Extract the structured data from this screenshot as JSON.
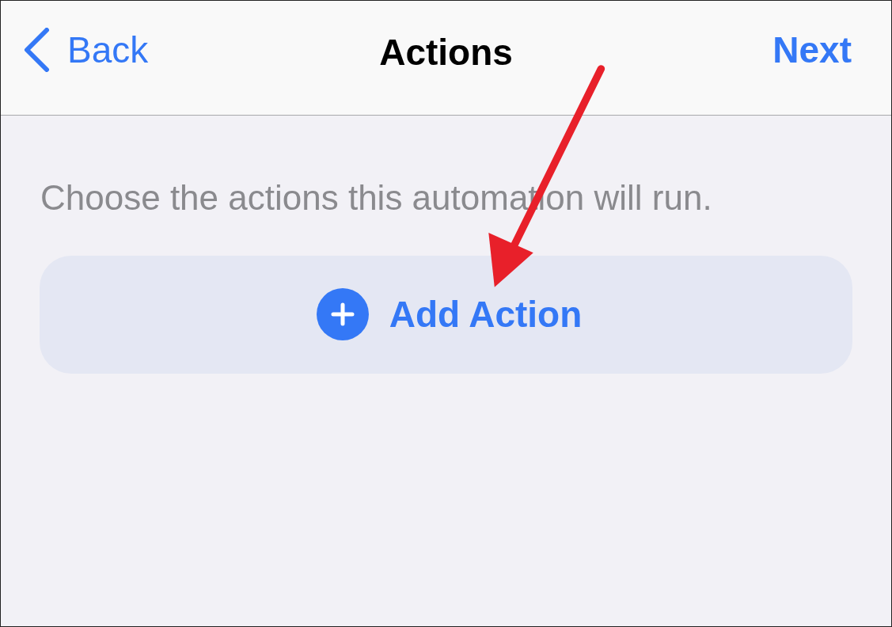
{
  "nav_bar": {
    "back": "Back",
    "title": "Actions",
    "next": "Next"
  },
  "description": "Choose the actions this automation will run.",
  "add_button": {
    "label": "Add Action"
  }
}
